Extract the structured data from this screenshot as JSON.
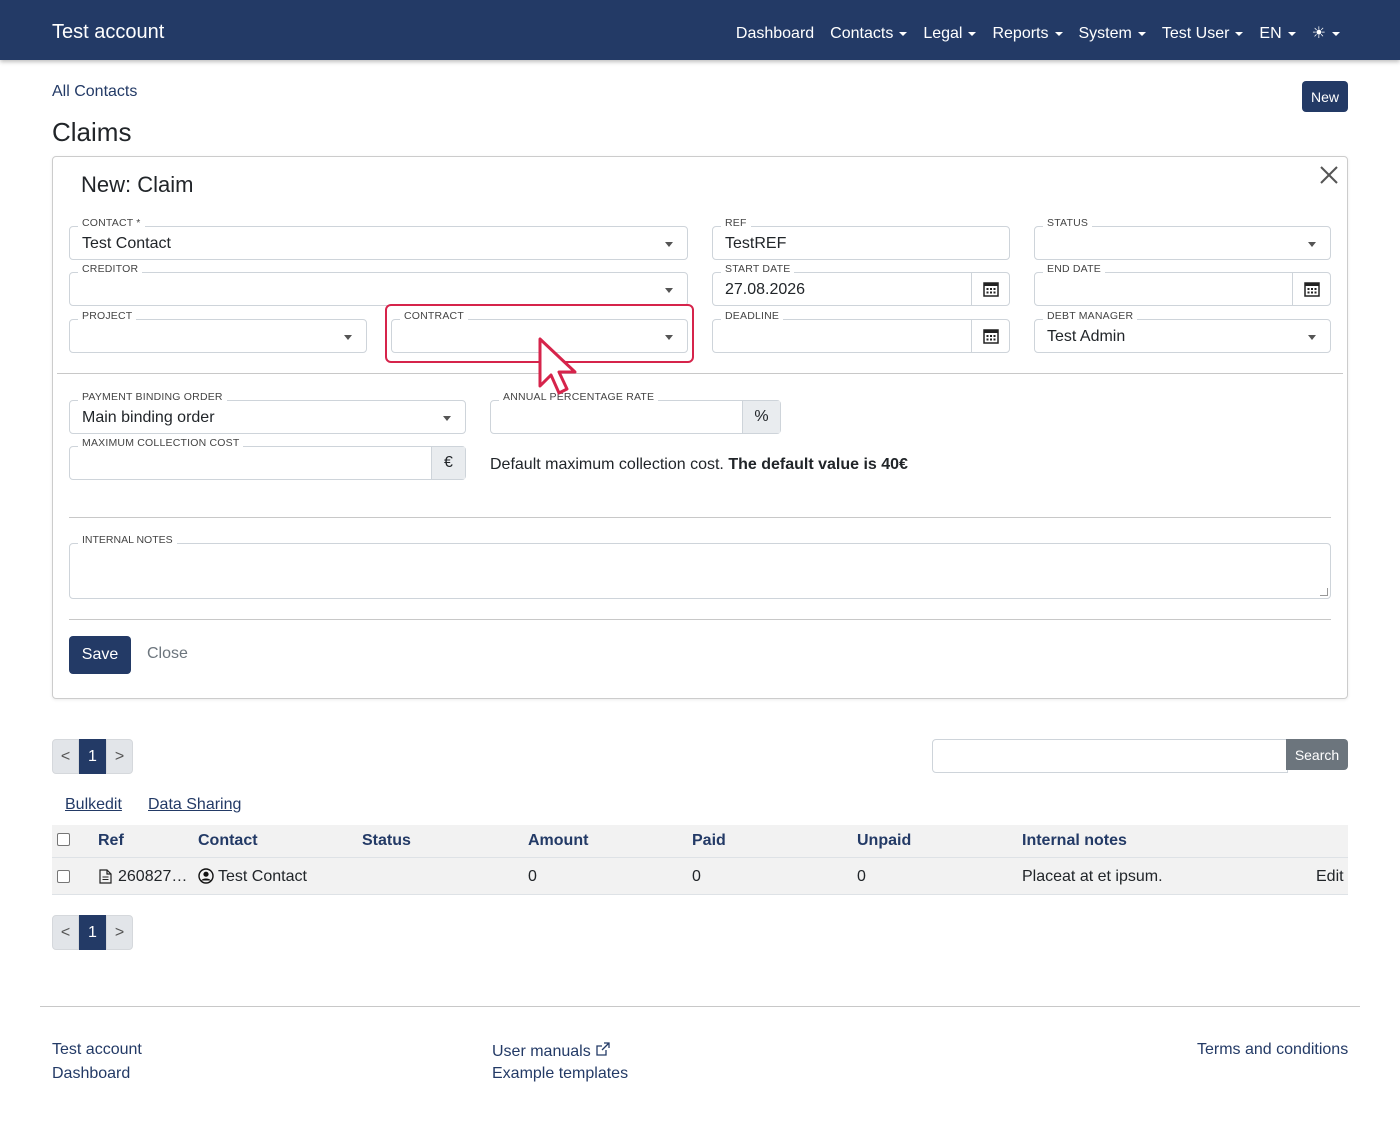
{
  "navbar": {
    "brand": "Test account",
    "items": [
      {
        "label": "Dashboard",
        "caret": false
      },
      {
        "label": "Contacts",
        "caret": true
      },
      {
        "label": "Legal",
        "caret": true
      },
      {
        "label": "Reports",
        "caret": true
      },
      {
        "label": "System",
        "caret": true
      },
      {
        "label": "Test User",
        "caret": true
      },
      {
        "label": "EN",
        "caret": true
      }
    ],
    "theme_icon": "☀"
  },
  "breadcrumb": "All Contacts",
  "new_button": "New",
  "page_title": "Claims",
  "form": {
    "title": "New: Claim",
    "contact": {
      "label": "CONTACT *",
      "value": "Test Contact"
    },
    "ref": {
      "label": "REF",
      "value": "TestREF"
    },
    "status": {
      "label": "STATUS",
      "value": ""
    },
    "creditor": {
      "label": "CREDITOR",
      "value": ""
    },
    "start_date": {
      "label": "START DATE",
      "value": "27.08.2026"
    },
    "end_date": {
      "label": "END DATE",
      "value": ""
    },
    "project": {
      "label": "PROJECT",
      "value": ""
    },
    "contract": {
      "label": "CONTRACT",
      "value": ""
    },
    "deadline": {
      "label": "DEADLINE",
      "value": ""
    },
    "debt_manager": {
      "label": "DEBT MANAGER",
      "value": "Test Admin"
    },
    "payment_binding_order": {
      "label": "PAYMENT BINDING ORDER",
      "value": "Main binding order"
    },
    "annual_percentage_rate": {
      "label": "ANNUAL PERCENTAGE RATE",
      "value": "",
      "addon": "%"
    },
    "maximum_collection_cost": {
      "label": "MAXIMUM COLLECTION COST",
      "value": "",
      "addon": "€"
    },
    "help_text": "Default maximum collection cost.",
    "help_bold": "The default value is 40€",
    "internal_notes": {
      "label": "INTERNAL NOTES",
      "value": ""
    },
    "save_label": "Save",
    "close_label": "Close"
  },
  "pagination": {
    "prev": "<",
    "page": "1",
    "next": ">"
  },
  "search": {
    "placeholder": "",
    "button": "Search"
  },
  "table_links": {
    "bulkedit": "Bulkedit",
    "data_sharing": "Data Sharing"
  },
  "table": {
    "headers": [
      "Ref",
      "Contact",
      "Status",
      "Amount",
      "Paid",
      "Unpaid",
      "Internal notes"
    ],
    "rows": [
      {
        "ref": "260827…",
        "contact": "Test Contact",
        "status": "",
        "amount": "0",
        "paid": "0",
        "unpaid": "0",
        "notes": "Placeat at et ipsum.",
        "action": "Edit"
      }
    ]
  },
  "footer": {
    "col1": [
      "Test account",
      "Dashboard"
    ],
    "col2": [
      "User manuals",
      "Example templates"
    ],
    "col3": [
      "Terms and conditions"
    ]
  }
}
